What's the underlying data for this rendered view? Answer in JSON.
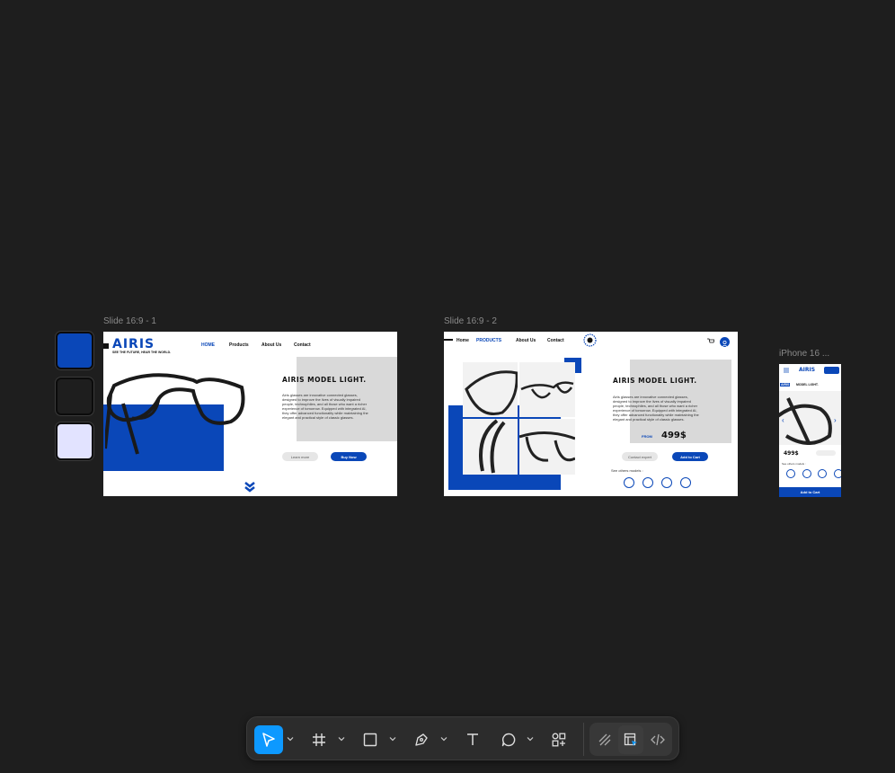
{
  "colors": {
    "canvas": "#1e1e1e",
    "accent": "#0a47b8",
    "swatch_blue": "#0a47b8",
    "swatch_dark": "#1e1e1e",
    "swatch_lavender": "#e2e3ff",
    "tool_active": "#0d99ff"
  },
  "swatches": [
    "#0a47b8",
    "#1e1e1e",
    "#e2e3ff"
  ],
  "frames": {
    "slide1": {
      "label": "Slide 16:9 - 1",
      "logo": "AIRIS",
      "tagline": "SEE THE FUTURE, HEAR THE WORLD.",
      "nav": [
        "HOME",
        "Products",
        "About Us",
        "Contact"
      ],
      "heading": "AIRIS MODEL LIGHT.",
      "description": "Airis glasses are innovative connected glasses, designed to improve the lives of visually impaired people, technophiles, and all those who want a richer experience of tomorrow. Equipped with integrated AI, they offer advanced functionality while maintaining the elegant and practical style of classic glasses.",
      "learn_more": "Learn more",
      "buy_now": "Buy Now"
    },
    "slide2": {
      "label": "Slide 16:9 - 2",
      "nav": [
        "Home",
        "PRODUCTS",
        "About Us",
        "Contact"
      ],
      "heading": "AIRIS MODEL LIGHT.",
      "description": "Airis glasses are innovative connected glasses, designed to improve the lives of visually impaired people, technophiles, and all those who want a richer experience of tomorrow. Equipped with integrated AI, they offer advanced functionality while maintaining the elegant and practical style of classic glasses.",
      "from_label": "FROM",
      "price": "499$",
      "contact_expert": "Contact expert",
      "add_to_cart": "Add to Cart",
      "see_others": "See others models :"
    },
    "iphone": {
      "label": "iPhone 16 ...",
      "logo": "AIRIS",
      "tag": "AIRIS",
      "heading": "MODEL LIGHT.",
      "price": "499$",
      "see_others": "See others models :",
      "add_to_cart": "Add to Cart"
    }
  },
  "toolbar": {
    "tools": [
      "move-tool",
      "frame-tool",
      "shape-tool",
      "pen-tool",
      "text-tool",
      "comment-tool",
      "actions-tool"
    ],
    "modes": [
      "draw-mode",
      "design-mode",
      "dev-mode"
    ]
  }
}
